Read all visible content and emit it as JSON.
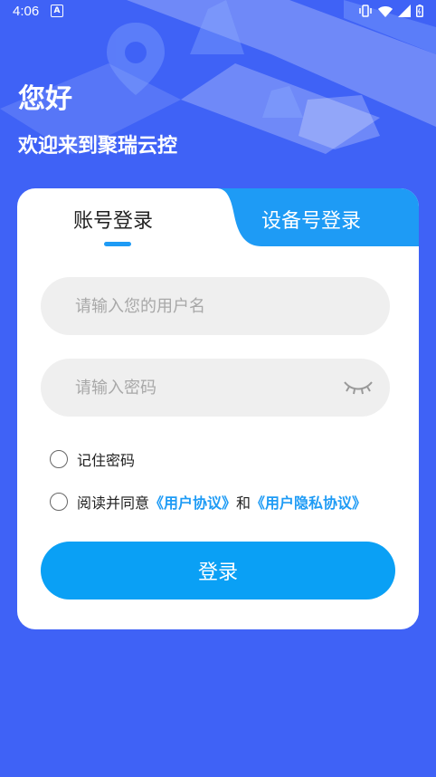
{
  "status_bar": {
    "time": "4:06",
    "notification_icon": "a-icon",
    "icons": [
      "vibrate-icon",
      "wifi-icon",
      "signal-icon",
      "battery-icon"
    ]
  },
  "header": {
    "greeting": "您好",
    "welcome": "欢迎来到聚瑞云控"
  },
  "tabs": [
    {
      "label": "账号登录",
      "active": true
    },
    {
      "label": "设备号登录",
      "active": false
    }
  ],
  "form": {
    "username_placeholder": "请输入您的用户名",
    "username_value": "",
    "password_placeholder": "请输入密码",
    "password_value": "",
    "remember_label": "记住密码",
    "agree_prefix": "阅读并同意",
    "user_agreement": "《用户协议》",
    "and": "和",
    "privacy_agreement": "《用户隐私协议》",
    "login_label": "登录"
  },
  "colors": {
    "background": "#3f62f6",
    "accent": "#1e9bf5",
    "button": "#0aa0f5"
  }
}
